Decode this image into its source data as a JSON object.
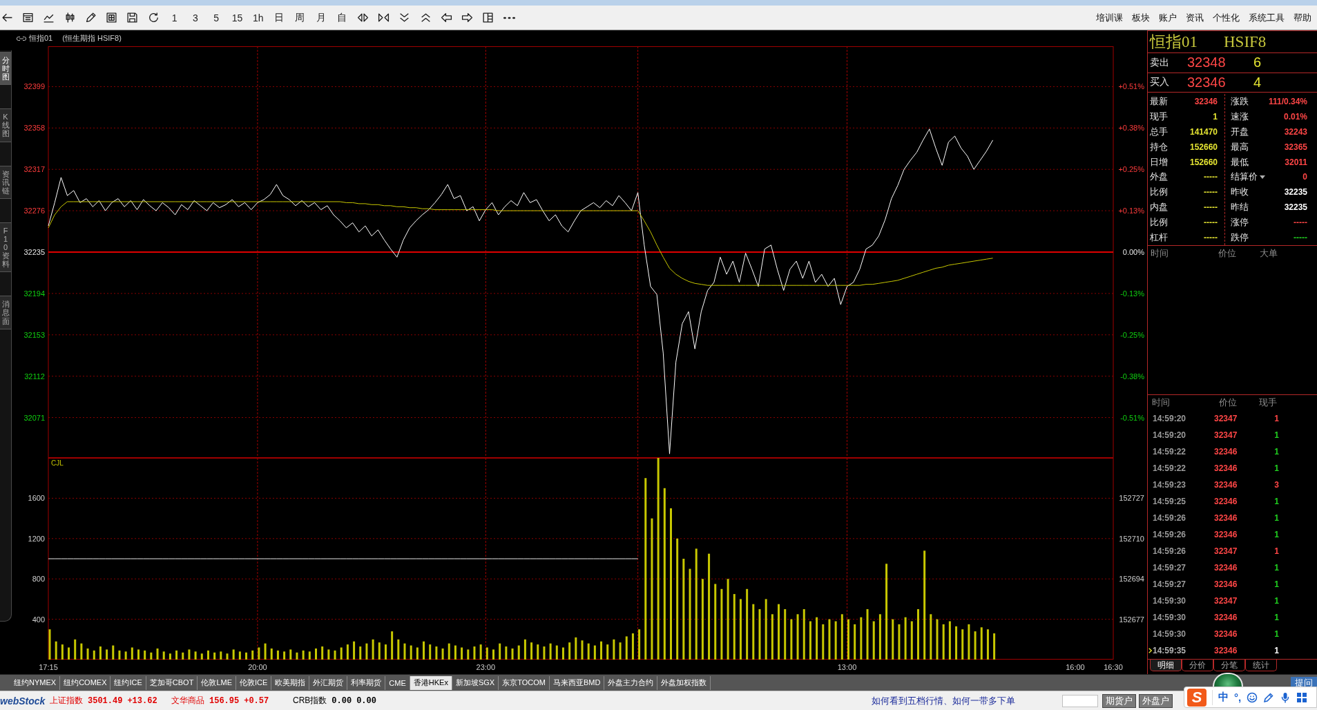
{
  "toolbar": {
    "periods": [
      "1",
      "3",
      "5",
      "15",
      "1h",
      "日",
      "周",
      "月",
      "自"
    ],
    "menu": [
      "培训课",
      "板块",
      "账户",
      "资讯",
      "个性化",
      "系统工具",
      "帮助"
    ]
  },
  "side_tabs": [
    {
      "label": "分时图",
      "selected": true
    },
    {
      "label": "K线图",
      "selected": false
    },
    {
      "label": "资讯链",
      "selected": false
    },
    {
      "label": "F10资料",
      "selected": false
    },
    {
      "label": "消息面",
      "selected": false
    }
  ],
  "chart_header": {
    "symbol": "恒指01",
    "name": "(恒生期指 HSIF8)"
  },
  "price_chart": {
    "right_axis_labels": [
      "+0.51%",
      "+0.38%",
      "+0.25%",
      "+0.13%",
      "0.00%",
      "-0.13%",
      "-0.25%",
      "-0.38%",
      "-0.51%"
    ],
    "chart_data": {
      "type": "line",
      "categories": [
        null,
        null,
        null,
        null,
        null,
        null,
        null,
        null,
        null,
        null,
        null,
        null,
        null,
        null,
        null,
        null,
        null,
        null,
        null,
        null,
        null,
        null,
        null,
        null,
        null,
        null,
        null,
        null,
        null,
        null,
        null,
        null,
        null,
        null,
        null,
        null,
        null,
        null,
        null,
        null,
        null,
        null,
        null,
        null,
        null,
        null,
        null,
        null,
        null,
        null,
        null,
        null,
        null,
        null,
        null,
        null,
        null,
        null,
        null,
        null,
        null,
        null,
        null,
        null,
        null,
        null,
        null,
        null,
        null,
        null,
        null,
        null,
        null,
        null,
        null,
        null,
        null,
        null,
        null,
        null,
        null,
        null,
        null,
        null,
        null,
        null,
        null,
        null,
        null,
        null,
        null,
        null,
        null,
        null,
        null,
        null,
        null,
        null,
        null,
        null,
        null,
        null,
        null,
        null,
        null,
        null,
        null,
        null,
        null,
        null,
        null,
        null,
        null,
        null,
        null,
        null,
        null,
        null,
        null,
        null,
        null,
        null,
        null,
        null,
        null,
        null,
        null,
        null,
        null,
        null,
        null,
        null,
        null,
        null,
        null,
        null,
        null,
        null,
        null,
        null,
        null,
        null,
        null,
        null,
        null,
        null,
        null,
        null,
        null,
        null,
        null,
        null,
        null,
        null,
        null,
        null,
        null,
        null,
        null,
        null,
        null,
        null,
        null,
        null,
        null,
        null,
        null,
        null,
        null
      ],
      "series": [
        {
          "color": "#ffffff",
          "values": [
            32261,
            32284,
            32309,
            32291,
            32296,
            32284,
            32288,
            32280,
            32286,
            32276,
            32284,
            32288,
            32280,
            32286,
            32277,
            32287,
            32281,
            32276,
            32284,
            32279,
            32272,
            32282,
            32277,
            32286,
            32281,
            32276,
            32284,
            32279,
            32282,
            32287,
            32280,
            32284,
            32277,
            32284,
            32287,
            32292,
            32302,
            32291,
            32287,
            32281,
            32286,
            32280,
            32284,
            32277,
            32281,
            32272,
            32266,
            32259,
            32264,
            32255,
            32261,
            32251,
            32257,
            32247,
            32238,
            32230,
            32247,
            32259,
            32266,
            32272,
            32277,
            32284,
            32292,
            32302,
            32288,
            32291,
            32276,
            32280,
            32266,
            32277,
            32284,
            32272,
            32280,
            32286,
            32281,
            32294,
            32284,
            32287,
            32276,
            32266,
            32272,
            32261,
            32255,
            32266,
            32276,
            32280,
            32284,
            32279,
            32286,
            32281,
            32291,
            32284,
            32276,
            32294,
            32242,
            32201,
            32193,
            32135,
            32035,
            32126,
            32164,
            32176,
            32139,
            32176,
            32197,
            32205,
            32230,
            32213,
            32226,
            32205,
            32234,
            32218,
            32201,
            32238,
            32242,
            32218,
            32197,
            32218,
            32226,
            32209,
            32226,
            32205,
            32213,
            32201,
            32209,
            32183,
            32201,
            32205,
            32218,
            32238,
            32242,
            32251,
            32267,
            32288,
            32301,
            32317,
            32326,
            32334,
            32346,
            32357,
            32338,
            32321,
            32344,
            32350,
            32338,
            32330,
            32317,
            32326,
            32335,
            32346,
            null,
            null,
            null,
            null,
            null,
            null,
            null,
            null,
            null,
            null,
            null,
            null,
            null,
            null,
            null,
            null,
            null,
            null,
            null
          ]
        },
        {
          "color": "#c8c800",
          "values": [
            32259,
            32272,
            32280,
            32285,
            32285,
            32285,
            32285,
            32285,
            32285,
            32285,
            32285,
            32285,
            32285,
            32285,
            32285,
            32285,
            32285,
            32285,
            32285,
            32285,
            32285,
            32285,
            32285,
            32285,
            32285,
            32285,
            32285,
            32285,
            32285,
            32285,
            32285,
            32285,
            32285,
            32285,
            32285,
            32285,
            32285,
            32285,
            32285,
            32285,
            32285,
            32285,
            32285,
            32285,
            32285,
            32285,
            32285,
            32284,
            32284,
            32283,
            32283,
            32282,
            32282,
            32281,
            32281,
            32280,
            32280,
            32279,
            32279,
            32278,
            32278,
            32277,
            32277,
            32277,
            32277,
            32277,
            32277,
            32277,
            32277,
            32277,
            32277,
            32276,
            32276,
            32276,
            32276,
            32276,
            32276,
            32276,
            32276,
            32276,
            32276,
            32276,
            32276,
            32276,
            32276,
            32276,
            32276,
            32276,
            32276,
            32276,
            32276,
            32276,
            32276,
            32276,
            32266,
            32255,
            32242,
            32230,
            32219,
            32213,
            32209,
            32206,
            32204,
            32203,
            32202,
            32202,
            32202,
            32202,
            32202,
            32202,
            32202,
            32202,
            32202,
            32202,
            32202,
            32202,
            32202,
            32202,
            32202,
            32202,
            32202,
            32202,
            32202,
            32202,
            32202,
            32202,
            32202,
            32202,
            32202,
            32203,
            32203,
            32204,
            32205,
            32206,
            32207,
            32209,
            32211,
            32213,
            32215,
            32217,
            32219,
            32220,
            32222,
            32223,
            32224,
            32225,
            32226,
            32227,
            32228,
            32229,
            null,
            null,
            null,
            null,
            null,
            null,
            null,
            null,
            null,
            null,
            null,
            null,
            null,
            null,
            null,
            null,
            null,
            null,
            null
          ]
        }
      ],
      "ylim": [
        32031,
        32439
      ],
      "yticks": [
        32399,
        32358,
        32317,
        32276,
        32235,
        32194,
        32153,
        32112,
        32071
      ],
      "grid": true,
      "ref_lines": [
        {
          "axis": "y",
          "value": 32235
        }
      ]
    }
  },
  "volume_chart": {
    "right_axis_labels": [
      "152727",
      "152710",
      "152694",
      "152677"
    ],
    "chart_data": {
      "type": "bar",
      "title": "CJL",
      "categories": [
        "17:15",
        null,
        null,
        null,
        null,
        null,
        null,
        null,
        null,
        null,
        null,
        null,
        null,
        null,
        null,
        null,
        null,
        null,
        null,
        null,
        null,
        null,
        null,
        null,
        null,
        null,
        null,
        null,
        null,
        null,
        null,
        null,
        null,
        "20:00",
        null,
        null,
        null,
        null,
        null,
        null,
        null,
        null,
        null,
        null,
        null,
        null,
        null,
        null,
        null,
        null,
        null,
        null,
        null,
        null,
        null,
        null,
        null,
        null,
        null,
        null,
        null,
        null,
        null,
        null,
        null,
        null,
        null,
        null,
        null,
        "23:00",
        null,
        null,
        null,
        null,
        null,
        null,
        null,
        null,
        null,
        null,
        null,
        null,
        null,
        null,
        null,
        null,
        null,
        null,
        null,
        null,
        null,
        null,
        null,
        null,
        null,
        null,
        null,
        null,
        null,
        null,
        null,
        null,
        null,
        null,
        null,
        null,
        null,
        null,
        null,
        null,
        null,
        null,
        null,
        null,
        null,
        null,
        null,
        null,
        null,
        null,
        null,
        null,
        null,
        null,
        null,
        null,
        "13:00",
        null,
        null,
        null,
        null,
        null,
        null,
        null,
        null,
        null,
        null,
        null,
        null,
        null,
        null,
        null,
        null,
        null,
        null,
        null,
        null,
        null,
        null,
        null,
        null,
        null,
        null,
        null,
        null,
        null,
        null,
        null,
        null,
        null,
        null,
        null,
        "16:00",
        null,
        null,
        null,
        null,
        null,
        "16:30"
      ],
      "series": [
        {
          "type": "bar",
          "color": "#c8c800",
          "values": [
            300,
            180,
            150,
            120,
            200,
            160,
            110,
            90,
            130,
            100,
            140,
            90,
            80,
            120,
            100,
            90,
            70,
            110,
            80,
            60,
            90,
            70,
            100,
            80,
            60,
            90,
            70,
            80,
            60,
            100,
            80,
            70,
            90,
            120,
            160,
            110,
            90,
            80,
            100,
            70,
            90,
            80,
            110,
            130,
            100,
            90,
            120,
            150,
            180,
            130,
            160,
            200,
            170,
            150,
            280,
            200,
            160,
            140,
            120,
            180,
            150,
            130,
            110,
            160,
            140,
            120,
            100,
            130,
            150,
            120,
            100,
            160,
            130,
            110,
            140,
            200,
            170,
            150,
            130,
            160,
            140,
            120,
            170,
            220,
            190,
            160,
            140,
            180,
            150,
            200,
            170,
            230,
            260,
            300,
            1800,
            1400,
            2000,
            1700,
            1500,
            1200,
            1000,
            900,
            1100,
            800,
            1050,
            750,
            700,
            800,
            650,
            600,
            700,
            550,
            500,
            600,
            450,
            550,
            500,
            400,
            450,
            500,
            380,
            420,
            350,
            400,
            380,
            450,
            400,
            350,
            420,
            500,
            380,
            450,
            950,
            400,
            350,
            420,
            380,
            500,
            1080,
            450,
            400,
            350,
            380,
            330,
            300,
            350,
            280,
            320,
            300,
            260,
            null,
            null,
            null,
            null,
            null,
            null,
            null,
            null,
            null,
            null,
            null,
            null,
            null,
            null,
            null,
            null,
            null,
            null,
            null
          ]
        },
        {
          "type": "line",
          "color": "#e6e6e6",
          "values": [
            1000,
            1000,
            1000,
            1000,
            1000,
            1000,
            1000,
            1000,
            1000,
            1000,
            1000,
            1000,
            1000,
            1000,
            1000,
            1000,
            1000,
            1000,
            1000,
            1000,
            1000,
            1000,
            1000,
            1000,
            1000,
            1000,
            1000,
            1000,
            1000,
            1000,
            1000,
            1000,
            1000,
            1000,
            1000,
            1000,
            1000,
            1000,
            1000,
            1000,
            1000,
            1000,
            1000,
            1000,
            1000,
            1000,
            1000,
            1000,
            1000,
            1000,
            1000,
            1000,
            1000,
            1000,
            1000,
            1000,
            1000,
            1000,
            1000,
            1000,
            1000,
            1000,
            1000,
            1000,
            1000,
            1000,
            1000,
            1000,
            1000,
            1000,
            1000,
            1000,
            1000,
            1000,
            1000,
            1000,
            1000,
            1000,
            1000,
            1000,
            1000,
            1000,
            1000,
            1000,
            1000,
            1000,
            1000,
            1000,
            1000,
            1000,
            1000,
            1000,
            1000,
            1000,
            null,
            null,
            null,
            null,
            null,
            null,
            null,
            null,
            null,
            null,
            null,
            null,
            null,
            null,
            null,
            null,
            null,
            null,
            null,
            null,
            null,
            null,
            null,
            null,
            null,
            null,
            null,
            null,
            null,
            null,
            null,
            null,
            null,
            null,
            null,
            null,
            null,
            null,
            null,
            null,
            null,
            null,
            null,
            null,
            null,
            null,
            null,
            null,
            null,
            null,
            null,
            null,
            null,
            null,
            null,
            null,
            null,
            null,
            null,
            null,
            null,
            null,
            null,
            null,
            null,
            null,
            null,
            null,
            null,
            null,
            null,
            null,
            null,
            null,
            null
          ]
        }
      ],
      "ylim": [
        0,
        2000
      ],
      "yticks": [
        1600,
        1200,
        800,
        400
      ],
      "grid": true
    }
  },
  "quote_panel": {
    "symbol": "恒指01",
    "code": "HSIF8",
    "ask": {
      "label": "卖出",
      "price": "32348",
      "volume": "6"
    },
    "bid": {
      "label": "买入",
      "price": "32346",
      "volume": "4"
    },
    "stats_left": [
      {
        "label": "最新",
        "value": "32346",
        "color": "#ff4646"
      },
      {
        "label": "现手",
        "value": "1",
        "color": "#e6e632"
      },
      {
        "label": "总手",
        "value": "141470",
        "color": "#e6e632"
      },
      {
        "label": "持仓",
        "value": "152660",
        "color": "#e6e632"
      },
      {
        "label": "日增",
        "value": "152660",
        "color": "#e6e632"
      },
      {
        "label": "外盘",
        "value": "-----",
        "color": "#e6e632"
      },
      {
        "label": "比例",
        "value": "-----",
        "color": "#e6e632"
      },
      {
        "label": "内盘",
        "value": "-----",
        "color": "#e6e632"
      },
      {
        "label": "比例",
        "value": "-----",
        "color": "#e6e632"
      },
      {
        "label": "杠杆",
        "value": "-----",
        "color": "#e6e632"
      }
    ],
    "stats_right": [
      {
        "label": "涨跌",
        "value": "111/0.34%",
        "color": "#ff4646",
        "kind": "plain"
      },
      {
        "label": "速涨",
        "value": "0.01%",
        "color": "#ff4646",
        "kind": "plain"
      },
      {
        "label": "开盘",
        "value": "32243",
        "color": "#ff4646",
        "kind": "plain"
      },
      {
        "label": "最高",
        "value": "32365",
        "color": "#ff4646",
        "kind": "plain"
      },
      {
        "label": "最低",
        "value": "32011",
        "color": "#ff4646",
        "kind": "plain"
      },
      {
        "label": "结算价",
        "value": "0",
        "color": "#ff4646",
        "kind": "dropdown"
      },
      {
        "label": "昨收",
        "value": "32235",
        "color": "#ffffff",
        "kind": "plain"
      },
      {
        "label": "昨结",
        "value": "32235",
        "color": "#ffffff",
        "kind": "plain"
      },
      {
        "label": "涨停",
        "value": "-----",
        "color": "#ff4646",
        "kind": "plain"
      },
      {
        "label": "跌停",
        "value": "-----",
        "color": "#20d020",
        "kind": "plain"
      }
    ],
    "big_orders": {
      "columns": [
        "时间",
        "价位",
        "大单"
      ]
    },
    "ticks": {
      "columns": [
        "时间",
        "价位",
        "现手"
      ],
      "rows": [
        {
          "time": "14:59:20",
          "price": "32347",
          "volume": "1",
          "color": "#ff4646",
          "selected": false
        },
        {
          "time": "14:59:20",
          "price": "32347",
          "volume": "1",
          "color": "#20d020",
          "selected": false
        },
        {
          "time": "14:59:22",
          "price": "32346",
          "volume": "1",
          "color": "#20d020",
          "selected": false
        },
        {
          "time": "14:59:22",
          "price": "32346",
          "volume": "1",
          "color": "#20d020",
          "selected": false
        },
        {
          "time": "14:59:23",
          "price": "32346",
          "volume": "3",
          "color": "#ff4646",
          "selected": false
        },
        {
          "time": "14:59:25",
          "price": "32346",
          "volume": "1",
          "color": "#20d020",
          "selected": false
        },
        {
          "time": "14:59:26",
          "price": "32346",
          "volume": "1",
          "color": "#20d020",
          "selected": false
        },
        {
          "time": "14:59:26",
          "price": "32346",
          "volume": "1",
          "color": "#20d020",
          "selected": false
        },
        {
          "time": "14:59:26",
          "price": "32347",
          "volume": "1",
          "color": "#ff4646",
          "selected": false
        },
        {
          "time": "14:59:27",
          "price": "32346",
          "volume": "1",
          "color": "#20d020",
          "selected": false
        },
        {
          "time": "14:59:27",
          "price": "32346",
          "volume": "1",
          "color": "#20d020",
          "selected": false
        },
        {
          "time": "14:59:30",
          "price": "32347",
          "volume": "1",
          "color": "#20d020",
          "selected": false
        },
        {
          "time": "14:59:30",
          "price": "32346",
          "volume": "1",
          "color": "#20d020",
          "selected": false
        },
        {
          "time": "14:59:30",
          "price": "32346",
          "volume": "1",
          "color": "#20d020",
          "selected": false
        },
        {
          "time": "14:59:35",
          "price": "32346",
          "volume": "1",
          "color": "#ffffff",
          "selected": true
        }
      ]
    },
    "tabs": [
      {
        "label": "明细",
        "selected": true
      },
      {
        "label": "分价",
        "selected": false
      },
      {
        "label": "分笔",
        "selected": false
      },
      {
        "label": "统计",
        "selected": false
      }
    ]
  },
  "market_tabs": [
    {
      "label": "纽约NYMEX",
      "selected": false
    },
    {
      "label": "纽约COMEX",
      "selected": false
    },
    {
      "label": "纽约ICE",
      "selected": false
    },
    {
      "label": "芝加哥CBOT",
      "selected": false
    },
    {
      "label": "伦敦LME",
      "selected": false
    },
    {
      "label": "伦敦ICE",
      "selected": false
    },
    {
      "label": "欧美期指",
      "selected": false
    },
    {
      "label": "外汇期货",
      "selected": false
    },
    {
      "label": "利率期货",
      "selected": false
    },
    {
      "label": "CME",
      "selected": false
    },
    {
      "label": "香港HKEx",
      "selected": true
    },
    {
      "label": "新加坡SGX",
      "selected": false
    },
    {
      "label": "东京TOCOM",
      "selected": false
    },
    {
      "label": "马来西亚BMD",
      "selected": false
    },
    {
      "label": "外盘主力合约",
      "selected": false
    },
    {
      "label": "外盘加权指数",
      "selected": false
    }
  ],
  "ask_button": "提问",
  "status_bar": {
    "logo": "webStock",
    "indices": [
      {
        "name": "上证指数",
        "value": "3501.49",
        "change": "+13.62",
        "color": "#e00000"
      },
      {
        "name": "文华商品",
        "value": "156.95",
        "change": "+0.57",
        "color": "#e00000"
      },
      {
        "name": "CRB指数",
        "value": "0.00",
        "change": "0.00",
        "color": "#000000"
      }
    ],
    "link": "如何看到五档行情、如何一带多下单",
    "account_buttons": [
      "期货户",
      "外盘户"
    ]
  },
  "ime_bar": {
    "logo": "S",
    "mode": "中",
    "punctuation": "°,"
  }
}
